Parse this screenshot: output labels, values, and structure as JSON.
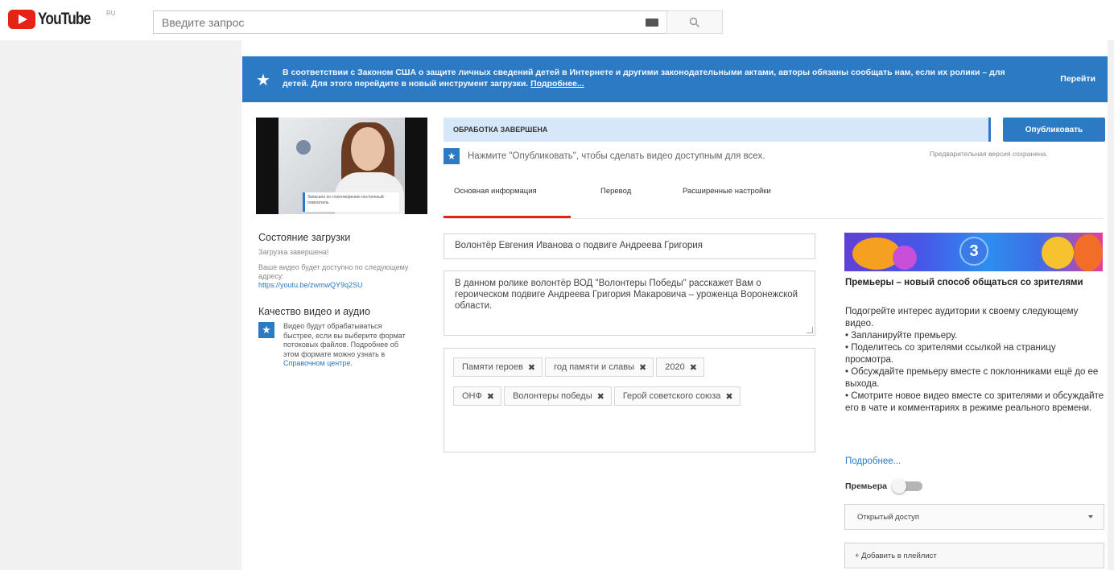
{
  "header": {
    "logo_text": "YouTube",
    "logo_region": "RU",
    "search_placeholder": "Введите запрос"
  },
  "banner": {
    "text": "В соответствии с Законом США о защите личных сведений детей в Интернете и другими законодательными актами, авторы обязаны сообщать нам, если их ролики – для детей. Для этого перейдите в новый инструмент загрузки.",
    "link": "Подробнее...",
    "go_label": "Перейти"
  },
  "thumbnail": {
    "caption": "Записано по стихотворению постоянный помогатель"
  },
  "upload_status": {
    "title": "Состояние загрузки",
    "status": "Загрузка завершена!",
    "availability": "Ваше видео будет доступно по следующему адресу:",
    "url": "https://youtu.be/zwmwQY9q2SU"
  },
  "quality": {
    "title": "Качество видео и аудио",
    "text": "Видео будут обрабатываться быстрее, если вы выберите формат потоковых файлов. Подробнее об этом формате можно узнать в ",
    "link": "Справочном центре",
    "end": "."
  },
  "processing": {
    "status": "ОБРАБОТКА ЗАВЕРШЕНА",
    "publish_label": "Опубликовать",
    "hint": "Нажмите \"Опубликовать\", чтобы сделать видео доступным для всех.",
    "preview_saved": "Предварительная версия сохранена."
  },
  "tabs": [
    {
      "label": "Основная информация"
    },
    {
      "label": "Перевод"
    },
    {
      "label": "Расширенные настройки"
    }
  ],
  "form": {
    "title": "Волонтёр Евгения Иванова о подвиге Андреева Григория",
    "description": "В данном ролике волонтёр ВОД \"Волонтеры Победы\" расскажет Вам о героическом подвиге Андреева Григория Макаровича – уроженца Воронежской области.",
    "tags": [
      "Памяти героев",
      "год памяти и славы",
      "2020",
      "ОНФ",
      "Волонтеры победы",
      "Герой советского союза"
    ]
  },
  "premiere_panel": {
    "badge": "3",
    "title": "Премьеры – новый способ общаться со зрителями",
    "intro": "Подогрейте интерес аудитории к своему следующему видео.",
    "points": [
      "• Запланируйте премьеру.",
      "• Поделитесь со зрителями ссылкой на страницу просмотра.",
      "• Обсуждайте премьеру вместе с поклонниками ещё до ее выхода.",
      "• Смотрите новое видео вместе со зрителями и обсуждайте его в чате и комментариях в режиме реального времени."
    ],
    "more_link": "Подробнее...",
    "premiere_label": "Премьера",
    "access_value": "Открытый доступ",
    "playlist_label": "+ Добавить в плейлист"
  },
  "colors": {
    "accent": "#2c79c4",
    "brand_red": "#e62117",
    "status_bg": "#d6e7fa"
  }
}
